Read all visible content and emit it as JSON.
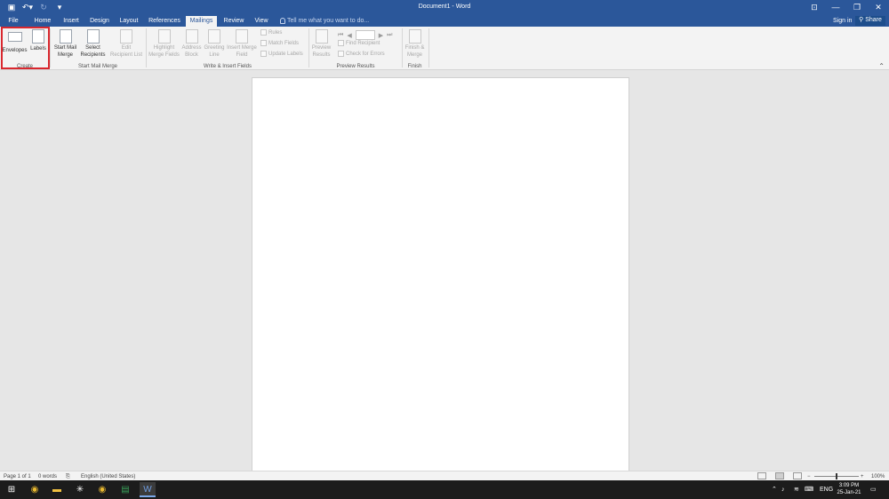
{
  "window": {
    "title": "Document1 - Word",
    "qat": {
      "save_icon": "save-icon",
      "undo_icon": "undo-icon",
      "redo_icon": "redo-icon",
      "customize_icon": "customize-icon"
    }
  },
  "tabs": [
    {
      "label": "File"
    },
    {
      "label": "Home"
    },
    {
      "label": "Insert"
    },
    {
      "label": "Design"
    },
    {
      "label": "Layout"
    },
    {
      "label": "References"
    },
    {
      "label": "Mailings",
      "active": true
    },
    {
      "label": "Review"
    },
    {
      "label": "View"
    }
  ],
  "tell_me": {
    "placeholder": "Tell me what you want to do..."
  },
  "account": {
    "sign_in": "Sign in",
    "share": "Share"
  },
  "ribbon": {
    "create": {
      "label": "Create",
      "envelopes": "Envelopes",
      "labels": "Labels"
    },
    "start_mail_merge": {
      "label": "Start Mail Merge",
      "start_line1": "Start Mail",
      "start_line2": "Merge",
      "select_line1": "Select",
      "select_line2": "Recipients",
      "edit_line1": "Edit",
      "edit_line2": "Recipient List"
    },
    "write_insert": {
      "label": "Write & Insert Fields",
      "highlight_line1": "Highlight",
      "highlight_line2": "Merge Fields",
      "address_line1": "Address",
      "address_line2": "Block",
      "greeting_line1": "Greeting",
      "greeting_line2": "Line",
      "insert_line1": "Insert Merge",
      "insert_line2": "Field",
      "rules": "Rules",
      "match_fields": "Match Fields",
      "update_labels": "Update Labels"
    },
    "preview": {
      "label": "Preview Results",
      "preview_line1": "Preview",
      "preview_line2": "Results",
      "find_recipient": "Find Recipient",
      "check_errors": "Check for Errors"
    },
    "finish": {
      "label": "Finish",
      "finish_line1": "Finish &",
      "finish_line2": "Merge"
    }
  },
  "status": {
    "page": "Page 1 of 1",
    "words": "0 words",
    "language": "English (United States)",
    "zoom": "100%"
  },
  "taskbar": {
    "language": "ENG",
    "time": "3:09 PM",
    "date": "25-Jan-21"
  }
}
